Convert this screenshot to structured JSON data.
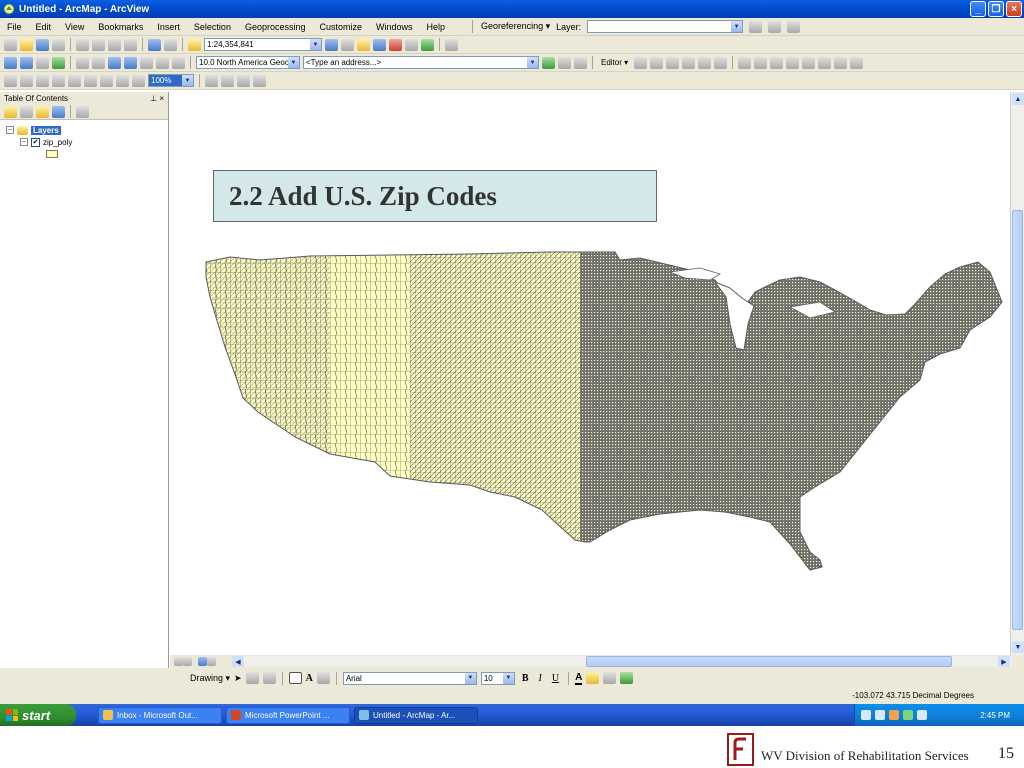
{
  "window": {
    "title": "Untitled - ArcMap - ArcView"
  },
  "menu": {
    "items": [
      "File",
      "Edit",
      "View",
      "Bookmarks",
      "Insert",
      "Selection",
      "Geoprocessing",
      "Customize",
      "Windows",
      "Help"
    ],
    "georeferencing": "Georeferencing ▾",
    "layer_label": "Layer:"
  },
  "toolbar": {
    "scale": "1:24,354,841",
    "locator": "10.0 North America Geoco",
    "address_placeholder": "<Type an address...>",
    "zoom_percent": "100%",
    "editor": "Editor ▾"
  },
  "toc": {
    "title": "Table Of Contents",
    "root_layer": "Layers",
    "layer": "zip_poly",
    "swatch_color": "#ffffc0"
  },
  "map": {
    "title": "2.2 Add U.S. Zip Codes",
    "title_box_bg": "#d4e8ea",
    "polygon_fill": "#ffffc0",
    "polygon_stroke": "#5a5a5a"
  },
  "drawing": {
    "label": "Drawing ▾",
    "font_name": "Arial",
    "font_size": "10",
    "bold": "B",
    "italic": "I",
    "underline": "U",
    "font_color_label": "A"
  },
  "status": {
    "coordinates": "-103.072  43.715 Decimal Degrees"
  },
  "taskbar": {
    "start": "start",
    "tasks": [
      "Inbox - Microsoft Out...",
      "Microsoft PowerPoint ...",
      "Untitled - ArcMap - Ar..."
    ],
    "clock": "2:45 PM"
  },
  "footer": {
    "org": "WV Division of Rehabilitation Services",
    "page": "15"
  }
}
